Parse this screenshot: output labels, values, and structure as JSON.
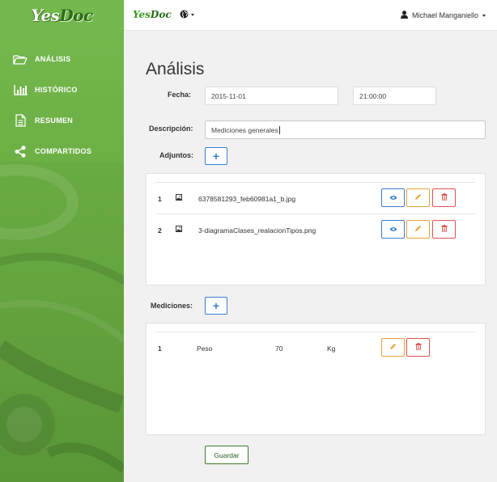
{
  "brand": {
    "yes": "Yes",
    "doc": "Doc"
  },
  "sidebar": {
    "items": [
      {
        "label": "ANÁLISIS",
        "icon": "folder-open-icon"
      },
      {
        "label": "HISTÓRICO",
        "icon": "bar-chart-icon"
      },
      {
        "label": "RESUMEN",
        "icon": "document-icon"
      },
      {
        "label": "COMPARTIDOS",
        "icon": "share-icon"
      }
    ]
  },
  "topbar": {
    "brand_yes": "Yes",
    "brand_doc": "Doc",
    "language_icon": "globe-icon",
    "user_name": "Michael Manganiello",
    "user_icon": "user-icon"
  },
  "main": {
    "title": "Análisis",
    "fecha_label": "Fecha:",
    "fecha_value": "2015-11-01",
    "hora_value": "21:00:00",
    "descripcion_label": "Descripción:",
    "descripcion_value": "Mediciones generales",
    "adjuntos_label": "Adjuntos:",
    "mediciones_label": "Mediciones:",
    "add_icon": "plus-icon",
    "save_label": "Guardar"
  },
  "adjuntos": [
    {
      "num": "1",
      "icon": "image-icon",
      "filename": "6378581293_feb60981a1_b.jpg"
    },
    {
      "num": "2",
      "icon": "image-icon",
      "filename": "3-diagramaClases_realacionTipos.png"
    }
  ],
  "mediciones": [
    {
      "num": "1",
      "name": "Peso",
      "value": "70",
      "unit": "Kg"
    }
  ],
  "colors": {
    "sidebar_green": "#6cb044",
    "primary_blue": "#3b7fd0",
    "warning_orange": "#e8a33b",
    "danger_red": "#d9534f",
    "save_green": "#3d7a2a"
  }
}
